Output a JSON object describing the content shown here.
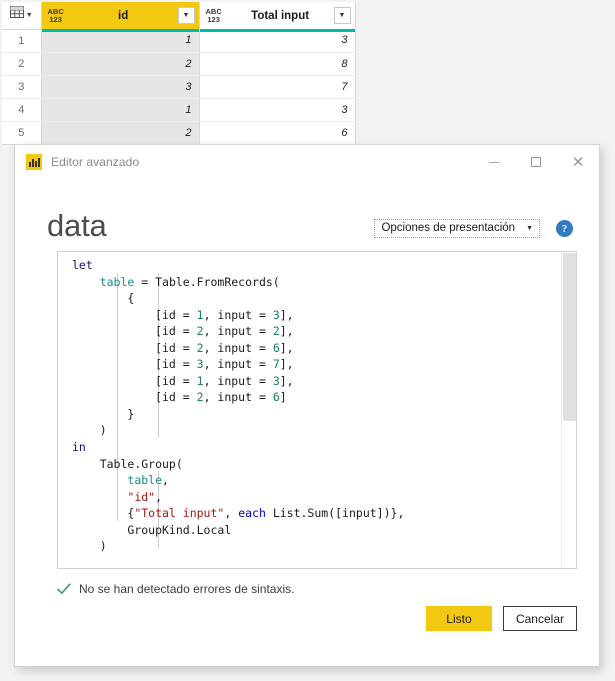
{
  "preview": {
    "corner_icon": "table-grid-icon",
    "columns": [
      {
        "label": "id",
        "type_icon": "ABC\n123",
        "selected": true,
        "filter_icon": "chevron-down-icon"
      },
      {
        "label": "Total input",
        "type_icon": "ABC\n123",
        "selected": false,
        "filter_icon": "chevron-down-icon"
      }
    ],
    "accent_underline_color": "#01b8aa",
    "selected_header_color": "#f2c811",
    "rows": [
      {
        "n": "1",
        "id": "1",
        "total": "3"
      },
      {
        "n": "2",
        "id": "2",
        "total": "8"
      },
      {
        "n": "3",
        "id": "3",
        "total": "7"
      },
      {
        "n": "4",
        "id": "1",
        "total": "3"
      },
      {
        "n": "5",
        "id": "2",
        "total": "6"
      }
    ]
  },
  "dialog": {
    "titlebar": {
      "app_icon": "power-bi-icon",
      "title": "Editor avanzado",
      "minimize_label": "",
      "maximize_label": "",
      "close_label": "✕"
    },
    "heading": "data",
    "display_options": {
      "label": "Opciones de presentación",
      "caret": "▼"
    },
    "help": {
      "icon": "help-icon",
      "glyph": "?"
    },
    "editor": {
      "language": "Power Query M",
      "lines": [
        "let",
        "    table = Table.FromRecords(",
        "        {",
        "            [id = 1, input = 3],",
        "            [id = 2, input = 2],",
        "            [id = 2, input = 6],",
        "            [id = 3, input = 7],",
        "            [id = 1, input = 3],",
        "            [id = 2, input = 6]",
        "        }",
        "    )",
        "in",
        "    Table.Group(",
        "        table,",
        "        \"id\",",
        "        {\"Total input\", each List.Sum([input])},",
        "        GroupKind.Local",
        "    )"
      ]
    },
    "status": {
      "icon": "checkmark-icon",
      "text": "No se han detectado errores de sintaxis.",
      "color": "#3f9c64"
    },
    "buttons": {
      "primary": "Listo",
      "secondary": "Cancelar"
    }
  }
}
